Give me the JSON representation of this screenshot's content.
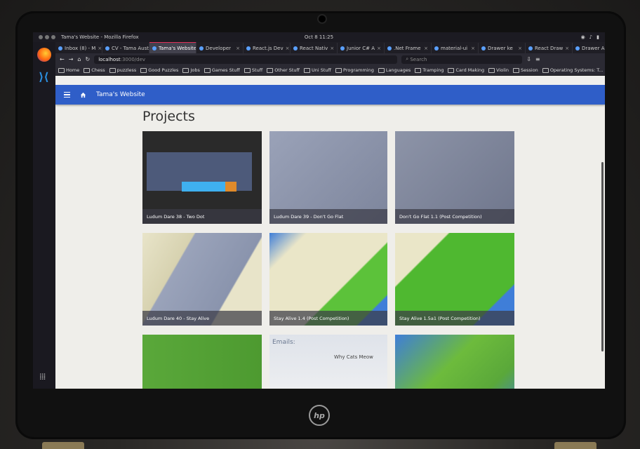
{
  "system": {
    "window_title": "Tama's Website - Mozilla Firefox",
    "clock": "Oct 8  11:25"
  },
  "tabs": [
    {
      "label": "Inbox (8) - M",
      "active": false
    },
    {
      "label": "CV - Tama Aust",
      "active": false
    },
    {
      "label": "Tama's Website",
      "active": true
    },
    {
      "label": "Developer",
      "active": false
    },
    {
      "label": "React.js Dev",
      "active": false
    },
    {
      "label": "React Nativ",
      "active": false
    },
    {
      "label": "Junior C# A",
      "active": false
    },
    {
      "label": ".Net Frame",
      "active": false
    },
    {
      "label": "material-ui",
      "active": false
    },
    {
      "label": "Drawer ke",
      "active": false
    },
    {
      "label": "React Draw",
      "active": false
    },
    {
      "label": "Drawer API",
      "active": false
    }
  ],
  "navbar": {
    "url_host": "localhost",
    "url_port": ":3000/dev",
    "search_placeholder": "Search"
  },
  "bookmarks": [
    "Home",
    "Chess",
    "puzzless",
    "Good Puzzles",
    "Jobs",
    "Games Stuff",
    "Stuff",
    "Other Stuff",
    "Uni Stuff",
    "Programming",
    "Languages",
    "Tramping",
    "Card Making",
    "Violin",
    "Session",
    "Operating Systems: T..."
  ],
  "appbar": {
    "title": "Tama's Website"
  },
  "page": {
    "heading": "Projects"
  },
  "projects": [
    {
      "caption": "Ludum Dare 38 - Two Dot"
    },
    {
      "caption": "Ludum Dare 39 - Don't Go Flat"
    },
    {
      "caption": "Don't Go Flat 1.1 (Post Competition)"
    },
    {
      "caption": "Ludum Dare 40 - Stay Alive"
    },
    {
      "caption": "Stay Alive 1.4 (Post Competition)"
    },
    {
      "caption": "Stay Alive 1.5a1 (Post Competition)"
    },
    {
      "caption": ""
    },
    {
      "caption": "Emails:"
    },
    {
      "caption": ""
    }
  ],
  "colors": {
    "appbar": "#2f5ec8",
    "tab_accent": "#e0305a"
  }
}
